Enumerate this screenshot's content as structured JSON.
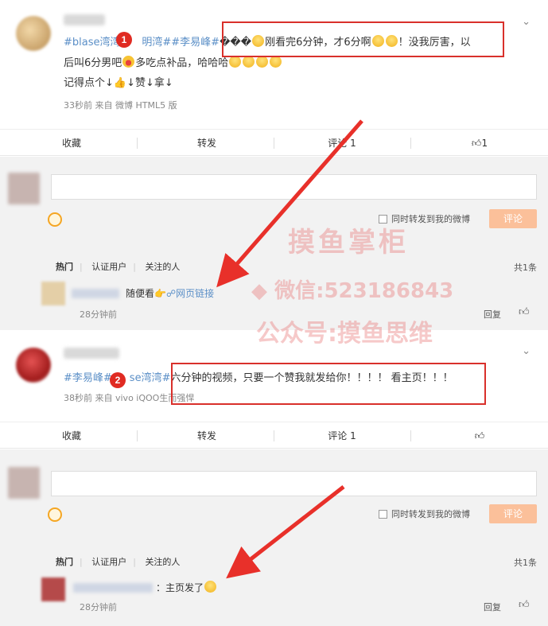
{
  "post1": {
    "line1_tags": "#blase湾湾#",
    "line1_tags2": "明湾##李易峰#",
    "line1_garble": "���",
    "line1_a": "刚看完6分钟",
    "line1_b": "，才6分啊",
    "line1_c": "！",
    "line1_d": "没我厉害",
    "line1_e": "，以",
    "line2_a": "后叫6分男吧",
    "line2_b": "多吃点补品，哈哈哈",
    "line3": "记得点个↓",
    "line3_b": "↓赞↓拿↓",
    "meta": "33秒前  来自 微博 HTML5 版",
    "actions": {
      "fav": "收藏",
      "repost": "转发",
      "comment": "评论 1",
      "like": "1"
    },
    "badge": "1"
  },
  "comments1": {
    "checkbox_label": "同时转发到我的微博",
    "submit": "评论",
    "tab_hot": "热门",
    "tab_verified": "认证用户",
    "tab_following": "关注的人",
    "total": "共1条",
    "comment_text": "随便看",
    "comment_link": "网页链接",
    "comment_time": "28分钟前",
    "reply": "回复"
  },
  "post2": {
    "tags_a": "#李易峰#",
    "tags_b": "se湾湾#",
    "text": "六分钟的视频，只要一个赞我就发给你！！！！ 看主页！！！",
    "meta": "38秒前  来自 vivo iQOO",
    "meta_b": "生而强悍",
    "actions": {
      "fav": "收藏",
      "repost": "转发",
      "comment": "评论 1",
      "like": ""
    },
    "badge": "2"
  },
  "comments2": {
    "checkbox_label": "同时转发到我的微博",
    "submit": "评论",
    "tab_hot": "热门",
    "tab_verified": "认证用户",
    "tab_following": "关注的人",
    "total": "共1条",
    "comment_text": "：主页发了",
    "comment_time": "28分钟前",
    "reply": "回复"
  },
  "watermark": {
    "line1": "摸鱼掌柜",
    "line2": "微信:523186843",
    "line3": "公众号:摸鱼思维"
  },
  "colors": {
    "tag_blue": "#5b8fc7",
    "annotation_red": "#d9302b",
    "submit_orange": "#fbc09a",
    "comment_bg": "#f2f2f2"
  }
}
